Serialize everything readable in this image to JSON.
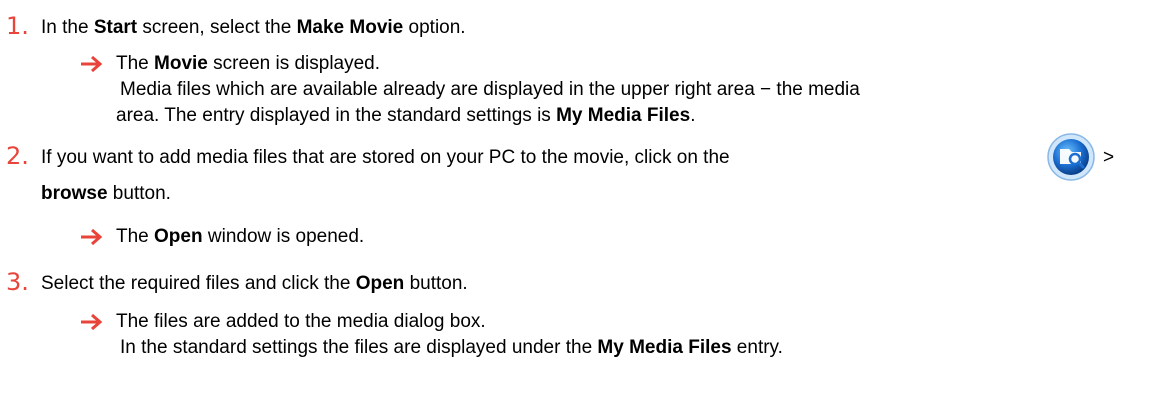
{
  "steps": [
    {
      "number": "1.",
      "parts": [
        "In the ",
        "Start",
        " screen, select the ",
        "Make Movie",
        " option."
      ],
      "result": {
        "parts": [
          "The ",
          "Movie",
          " screen is displayed."
        ],
        "line2": "Media files which are available already are displayed in the upper right area − the media",
        "line3_parts": [
          "area. The entry displayed in the standard settings is ",
          "My Media Files",
          "."
        ]
      }
    },
    {
      "number": "2.",
      "line1": "If you want to add media files that are stored on your PC to the movie, click on the",
      "gt": ">",
      "line2_parts": [
        "browse",
        " button."
      ],
      "result": {
        "parts": [
          "The ",
          "Open",
          " window is opened."
        ]
      }
    },
    {
      "number": "3.",
      "parts": [
        "Select the required files and click the ",
        "Open",
        " button."
      ],
      "result": {
        "line1": "The files are added to the media dialog box.",
        "line2_parts": [
          "In the standard settings the files are displayed under the ",
          "My Media Files",
          " entry."
        ]
      }
    }
  ],
  "icons": {
    "arrow": "right-arrow-icon",
    "browse": "browse-button-icon"
  },
  "colors": {
    "step_number": "#e8443a",
    "arrow": "#e8443a",
    "icon_blue": "#1a6fd1"
  }
}
